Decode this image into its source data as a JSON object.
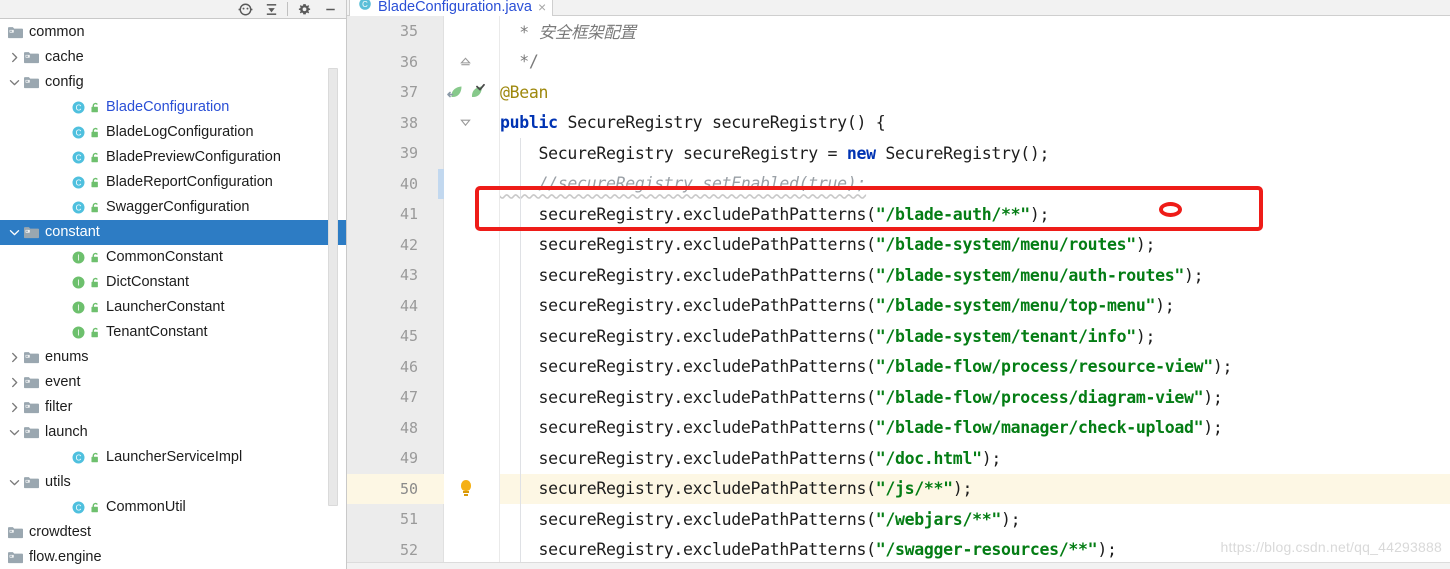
{
  "project_panel": {
    "toolbar": {
      "buttons": [
        {
          "name": "locate-icon",
          "title": "Select Opened File"
        },
        {
          "name": "collapse-all-icon",
          "title": "Collapse All"
        },
        {
          "name": "gear-icon",
          "title": "Settings"
        },
        {
          "name": "minimize-icon",
          "title": "Hide"
        }
      ]
    },
    "tree": [
      {
        "label": "common",
        "indent": 0,
        "twist": "none",
        "icon": "folder",
        "kind": "package",
        "selected": false
      },
      {
        "label": "cache",
        "indent": 1,
        "twist": "collapsed",
        "icon": "folder",
        "kind": "package",
        "selected": false
      },
      {
        "label": "config",
        "indent": 1,
        "twist": "expanded",
        "icon": "folder",
        "kind": "package",
        "selected": false
      },
      {
        "label": "BladeConfiguration",
        "indent": 3,
        "twist": "none",
        "icon": "class",
        "kind": "class",
        "selected": false,
        "link": true
      },
      {
        "label": "BladeLogConfiguration",
        "indent": 3,
        "twist": "none",
        "icon": "class",
        "kind": "class",
        "selected": false
      },
      {
        "label": "BladePreviewConfiguration",
        "indent": 3,
        "twist": "none",
        "icon": "class",
        "kind": "class",
        "selected": false
      },
      {
        "label": "BladeReportConfiguration",
        "indent": 3,
        "twist": "none",
        "icon": "class",
        "kind": "class",
        "selected": false
      },
      {
        "label": "SwaggerConfiguration",
        "indent": 3,
        "twist": "none",
        "icon": "class",
        "kind": "class",
        "selected": false
      },
      {
        "label": "constant",
        "indent": 1,
        "twist": "expanded",
        "icon": "folder",
        "kind": "package",
        "selected": true
      },
      {
        "label": "CommonConstant",
        "indent": 3,
        "twist": "none",
        "icon": "interface",
        "kind": "interface",
        "selected": false
      },
      {
        "label": "DictConstant",
        "indent": 3,
        "twist": "none",
        "icon": "interface",
        "kind": "interface",
        "selected": false
      },
      {
        "label": "LauncherConstant",
        "indent": 3,
        "twist": "none",
        "icon": "interface",
        "kind": "interface",
        "selected": false
      },
      {
        "label": "TenantConstant",
        "indent": 3,
        "twist": "none",
        "icon": "interface",
        "kind": "interface",
        "selected": false
      },
      {
        "label": "enums",
        "indent": 1,
        "twist": "collapsed",
        "icon": "folder",
        "kind": "package",
        "selected": false
      },
      {
        "label": "event",
        "indent": 1,
        "twist": "collapsed",
        "icon": "folder",
        "kind": "package",
        "selected": false
      },
      {
        "label": "filter",
        "indent": 1,
        "twist": "collapsed",
        "icon": "folder",
        "kind": "package",
        "selected": false
      },
      {
        "label": "launch",
        "indent": 1,
        "twist": "expanded",
        "icon": "folder",
        "kind": "package",
        "selected": false
      },
      {
        "label": "LauncherServiceImpl",
        "indent": 3,
        "twist": "none",
        "icon": "class",
        "kind": "class",
        "selected": false
      },
      {
        "label": "utils",
        "indent": 1,
        "twist": "expanded",
        "icon": "folder",
        "kind": "package",
        "selected": false
      },
      {
        "label": "CommonUtil",
        "indent": 3,
        "twist": "none",
        "icon": "class",
        "kind": "class",
        "selected": false
      },
      {
        "label": "crowdtest",
        "indent": 0,
        "twist": "none",
        "icon": "folder",
        "kind": "package",
        "selected": false
      },
      {
        "label": "flow.engine",
        "indent": 0,
        "twist": "none",
        "icon": "folder",
        "kind": "package",
        "selected": false
      }
    ]
  },
  "editor": {
    "tab": {
      "filename": "BladeConfiguration.java",
      "icon": "class-icon",
      "close": "×"
    },
    "lines": [
      {
        "num": "35",
        "gutter": "none",
        "highlight": false,
        "fold": "none",
        "change": false,
        "segments": [
          {
            "t": "  * ",
            "c": "docstar"
          },
          {
            "t": "安全框架配置",
            "c": "doccn"
          }
        ]
      },
      {
        "num": "36",
        "gutter": "none",
        "highlight": false,
        "fold": "end",
        "change": false,
        "segments": [
          {
            "t": "  */",
            "c": "docstar"
          }
        ]
      },
      {
        "num": "37",
        "gutter": "bean",
        "highlight": false,
        "fold": "none",
        "change": false,
        "segments": [
          {
            "t": "@Bean",
            "c": "ann"
          }
        ]
      },
      {
        "num": "38",
        "gutter": "none",
        "highlight": false,
        "fold": "start",
        "change": false,
        "segments": [
          {
            "t": "public ",
            "c": "kw"
          },
          {
            "t": "SecureRegistry secureRegistry() {",
            "c": "plain"
          }
        ]
      },
      {
        "num": "39",
        "gutter": "none",
        "highlight": false,
        "fold": "none",
        "change": false,
        "segments": [
          {
            "t": "    SecureRegistry secureRegistry = ",
            "c": "plain"
          },
          {
            "t": "new ",
            "c": "kw"
          },
          {
            "t": "SecureRegistry();",
            "c": "plain"
          }
        ]
      },
      {
        "num": "40",
        "gutter": "none",
        "highlight": false,
        "fold": "none",
        "change": true,
        "segments": [
          {
            "t": "    //secureRegistry.setEnabled(true);",
            "c": "cmt-bad"
          }
        ]
      },
      {
        "num": "41",
        "gutter": "none",
        "highlight": false,
        "fold": "none",
        "change": false,
        "segments": [
          {
            "t": "    secureRegistry.excludePathPatterns(",
            "c": "plain"
          },
          {
            "t": "\"/blade-auth/**\"",
            "c": "str"
          },
          {
            "t": ");",
            "c": "plain"
          }
        ]
      },
      {
        "num": "42",
        "gutter": "none",
        "highlight": false,
        "fold": "none",
        "change": false,
        "segments": [
          {
            "t": "    secureRegistry.excludePathPatterns(",
            "c": "plain"
          },
          {
            "t": "\"/blade-system/menu/routes\"",
            "c": "str"
          },
          {
            "t": ");",
            "c": "plain"
          }
        ]
      },
      {
        "num": "43",
        "gutter": "none",
        "highlight": false,
        "fold": "none",
        "change": false,
        "segments": [
          {
            "t": "    secureRegistry.excludePathPatterns(",
            "c": "plain"
          },
          {
            "t": "\"/blade-system/menu/auth-routes\"",
            "c": "str"
          },
          {
            "t": ");",
            "c": "plain"
          }
        ]
      },
      {
        "num": "44",
        "gutter": "none",
        "highlight": false,
        "fold": "none",
        "change": false,
        "segments": [
          {
            "t": "    secureRegistry.excludePathPatterns(",
            "c": "plain"
          },
          {
            "t": "\"/blade-system/menu/top-menu\"",
            "c": "str"
          },
          {
            "t": ");",
            "c": "plain"
          }
        ]
      },
      {
        "num": "45",
        "gutter": "none",
        "highlight": false,
        "fold": "none",
        "change": false,
        "segments": [
          {
            "t": "    secureRegistry.excludePathPatterns(",
            "c": "plain"
          },
          {
            "t": "\"/blade-system/tenant/info\"",
            "c": "str"
          },
          {
            "t": ");",
            "c": "plain"
          }
        ]
      },
      {
        "num": "46",
        "gutter": "none",
        "highlight": false,
        "fold": "none",
        "change": false,
        "segments": [
          {
            "t": "    secureRegistry.excludePathPatterns(",
            "c": "plain"
          },
          {
            "t": "\"/blade-flow/process/resource-view\"",
            "c": "str"
          },
          {
            "t": ");",
            "c": "plain"
          }
        ]
      },
      {
        "num": "47",
        "gutter": "none",
        "highlight": false,
        "fold": "none",
        "change": false,
        "segments": [
          {
            "t": "    secureRegistry.excludePathPatterns(",
            "c": "plain"
          },
          {
            "t": "\"/blade-flow/process/diagram-view\"",
            "c": "str"
          },
          {
            "t": ");",
            "c": "plain"
          }
        ]
      },
      {
        "num": "48",
        "gutter": "none",
        "highlight": false,
        "fold": "none",
        "change": false,
        "segments": [
          {
            "t": "    secureRegistry.excludePathPatterns(",
            "c": "plain"
          },
          {
            "t": "\"/blade-flow/manager/check-upload\"",
            "c": "str"
          },
          {
            "t": ");",
            "c": "plain"
          }
        ]
      },
      {
        "num": "49",
        "gutter": "none",
        "highlight": false,
        "fold": "none",
        "change": false,
        "segments": [
          {
            "t": "    secureRegistry.excludePathPatterns(",
            "c": "plain"
          },
          {
            "t": "\"/doc.html\"",
            "c": "str"
          },
          {
            "t": ");",
            "c": "plain"
          }
        ]
      },
      {
        "num": "50",
        "gutter": "bulb",
        "highlight": true,
        "fold": "none",
        "change": false,
        "segments": [
          {
            "t": "    secureRegistry.excludePathPatterns(",
            "c": "plain"
          },
          {
            "t": "\"/js/**\"",
            "c": "str"
          },
          {
            "t": ");",
            "c": "plain"
          }
        ]
      },
      {
        "num": "51",
        "gutter": "none",
        "highlight": false,
        "fold": "none",
        "change": false,
        "segments": [
          {
            "t": "    secureRegistry.excludePathPatterns(",
            "c": "plain"
          },
          {
            "t": "\"/webjars/**\"",
            "c": "str"
          },
          {
            "t": ");",
            "c": "plain"
          }
        ]
      },
      {
        "num": "52",
        "gutter": "none",
        "highlight": false,
        "fold": "none",
        "change": false,
        "segments": [
          {
            "t": "    secureRegistry.excludePathPatterns(",
            "c": "plain"
          },
          {
            "t": "\"/swagger-resources/**\"",
            "c": "str"
          },
          {
            "t": ");",
            "c": "plain"
          }
        ]
      }
    ]
  },
  "annotations": {
    "highlight_box": {
      "shape": "rectangle",
      "color": "#ee1c18"
    },
    "marker_oval": {
      "shape": "oval",
      "color": "#ee1c18"
    }
  },
  "watermark": "https://blog.csdn.net/qq_44293888",
  "colors": {
    "selection_blue": "#2d7cc4",
    "keyword_blue": "#0033b3",
    "string_green": "#047d14",
    "annotation_yellow": "#9e880d",
    "annotation_red": "#ee1c18",
    "current_line": "#fdf7e4"
  }
}
